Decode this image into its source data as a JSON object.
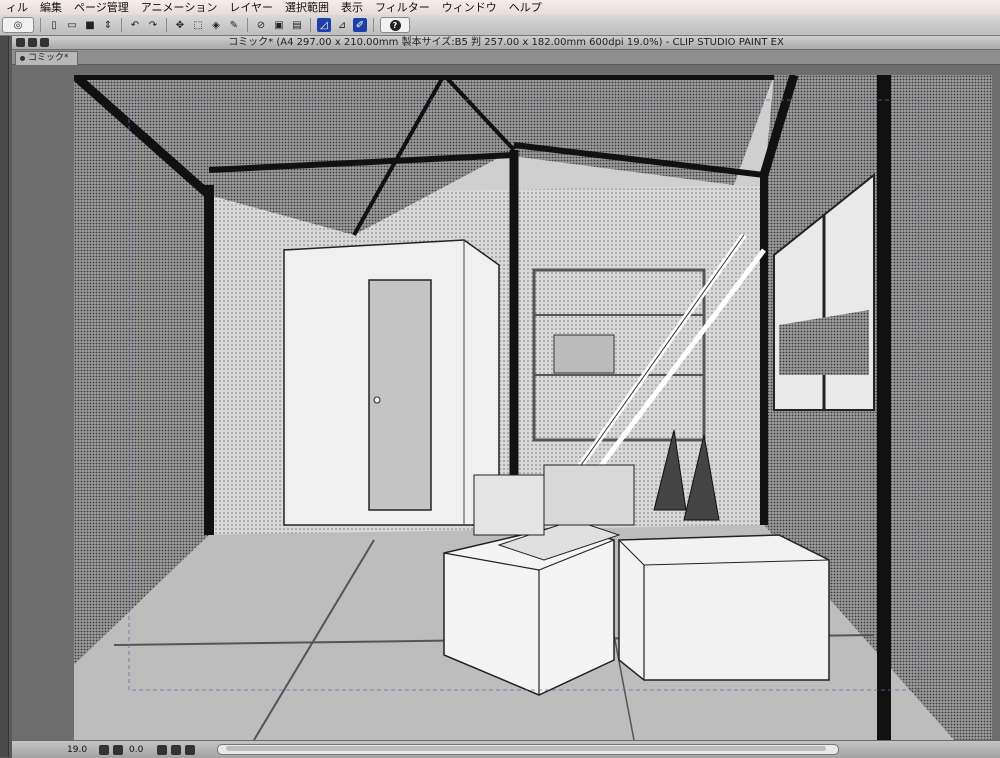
{
  "menu": [
    "ィル",
    "編集",
    "ページ管理",
    "アニメーション",
    "レイヤー",
    "選択範囲",
    "表示",
    "フィルター",
    "ウィンドウ",
    "ヘルプ"
  ],
  "window_title": "コミック* (A4 297.00 x 210.00mm 製本サイズ:B5 判 257.00 x 182.00mm 600dpi 19.0%)  - CLIP STUDIO PAINT EX",
  "tab_label": "コミック*",
  "status": {
    "zoom": "19.0",
    "rotation": "0.0"
  },
  "toolbar_icons": [
    "clip-studio-logo-icon",
    "new-file-icon",
    "open-file-icon",
    "save-icon",
    "undo-icon",
    "redo-icon",
    "transform-icon",
    "selection-icon",
    "fill-icon",
    "ruler-icon",
    "perspective-icon",
    "pen-icon",
    "help-icon"
  ],
  "colors": {
    "menubar": "#f1e7e3",
    "toolbar": "#c9c9c9",
    "canvas_bg": "#6e6e6e",
    "accent": "#1f3fa8"
  }
}
